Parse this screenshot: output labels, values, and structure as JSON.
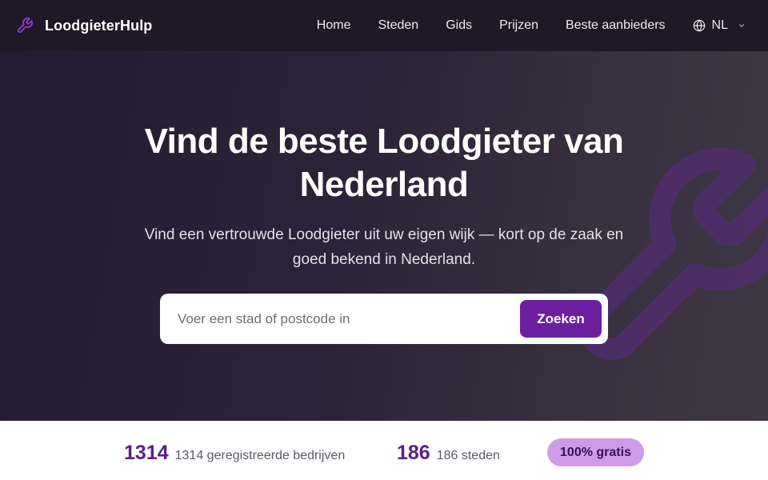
{
  "header": {
    "brand": "LoodgieterHulp",
    "nav": [
      "Home",
      "Steden",
      "Gids",
      "Prijzen",
      "Beste aanbieders"
    ],
    "language": "NL"
  },
  "hero": {
    "title": "Vind de beste Loodgieter van Nederland",
    "subtitle": "Vind een vertrouwde Loodgieter uit uw eigen wijk — kort op de zaak en goed bekend in Nederland."
  },
  "search": {
    "placeholder": "Voer een stad of postcode in",
    "button": "Zoeken"
  },
  "stats": {
    "companies_number": "1314",
    "companies_label": "1314 geregistreerde bedrijven",
    "cities_number": "186",
    "cities_label": "186 steden",
    "free_badge": "100% gratis"
  },
  "colors": {
    "accent": "#6b1fa0",
    "header_bg": "#1f1827",
    "badge_bg": "#cf9be6"
  },
  "icons": {
    "brand": "wrench-icon",
    "language": "globe-icon",
    "language_toggle": "chevron-down-icon",
    "hero_decoration": "wrench-icon"
  }
}
